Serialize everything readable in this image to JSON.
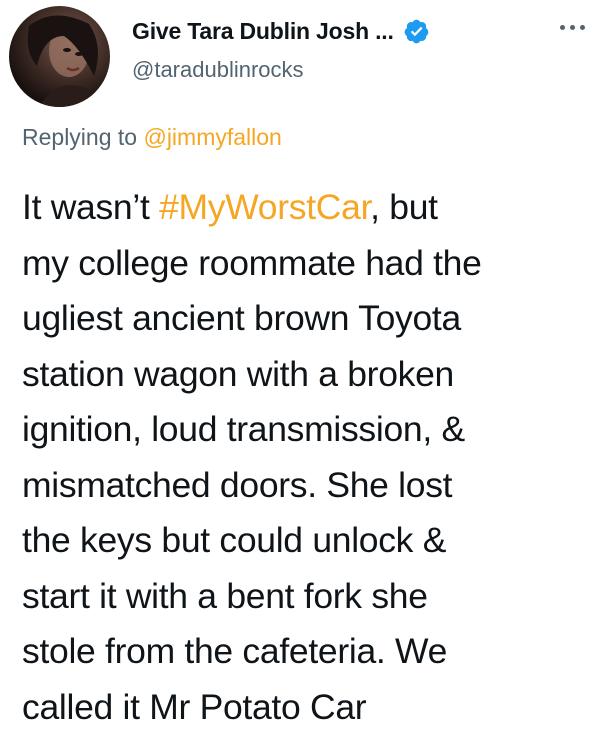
{
  "author": {
    "display_name": "Give Tara Dublin Josh ...",
    "handle": "@taradublinrocks",
    "verified": true,
    "avatar_icon": "profile-photo"
  },
  "reply": {
    "prefix": "Replying to ",
    "mention": "@jimmyfallon"
  },
  "tweet": {
    "lines": [
      {
        "before": "It wasn’t ",
        "hashtag": "#MyWorstCar",
        "after": ", but"
      },
      {
        "text": "my college roommate had the"
      },
      {
        "text": "ugliest ancient brown Toyota"
      },
      {
        "text": "station wagon with a broken"
      },
      {
        "text": "ignition, loud transmission, &"
      },
      {
        "text": "mismatched doors. She lost"
      },
      {
        "text": "the keys but could unlock &"
      },
      {
        "text": "start it with a bent fork she"
      },
      {
        "text": "stole from the cafeteria. We"
      },
      {
        "text": "called it Mr Potato Car"
      }
    ]
  },
  "colors": {
    "accent": "#f5a623",
    "verified_badge": "#1d9bf0",
    "secondary_text": "#536471",
    "primary_text": "#0f1419"
  },
  "icons": {
    "verified": "verified-badge-icon",
    "more": "more-options-icon"
  }
}
